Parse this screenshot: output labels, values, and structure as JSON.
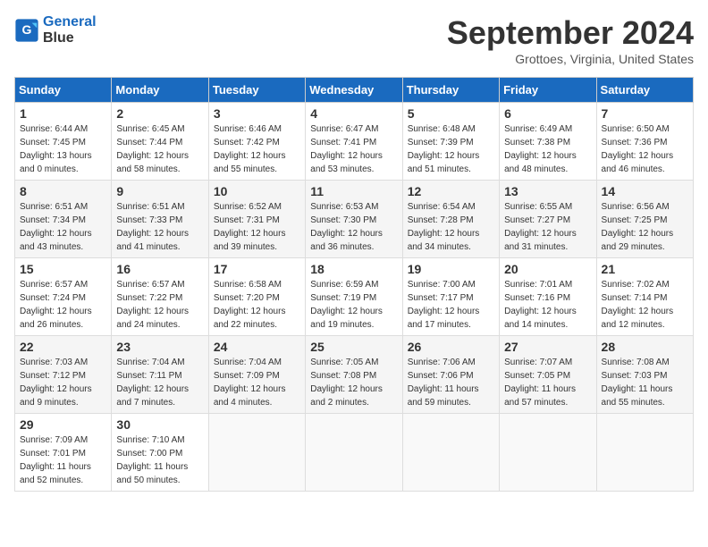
{
  "header": {
    "logo_line1": "General",
    "logo_line2": "Blue",
    "month_title": "September 2024",
    "location": "Grottoes, Virginia, United States"
  },
  "columns": [
    "Sunday",
    "Monday",
    "Tuesday",
    "Wednesday",
    "Thursday",
    "Friday",
    "Saturday"
  ],
  "weeks": [
    [
      {
        "day": "1",
        "info": "Sunrise: 6:44 AM\nSunset: 7:45 PM\nDaylight: 13 hours\nand 0 minutes."
      },
      {
        "day": "2",
        "info": "Sunrise: 6:45 AM\nSunset: 7:44 PM\nDaylight: 12 hours\nand 58 minutes."
      },
      {
        "day": "3",
        "info": "Sunrise: 6:46 AM\nSunset: 7:42 PM\nDaylight: 12 hours\nand 55 minutes."
      },
      {
        "day": "4",
        "info": "Sunrise: 6:47 AM\nSunset: 7:41 PM\nDaylight: 12 hours\nand 53 minutes."
      },
      {
        "day": "5",
        "info": "Sunrise: 6:48 AM\nSunset: 7:39 PM\nDaylight: 12 hours\nand 51 minutes."
      },
      {
        "day": "6",
        "info": "Sunrise: 6:49 AM\nSunset: 7:38 PM\nDaylight: 12 hours\nand 48 minutes."
      },
      {
        "day": "7",
        "info": "Sunrise: 6:50 AM\nSunset: 7:36 PM\nDaylight: 12 hours\nand 46 minutes."
      }
    ],
    [
      {
        "day": "8",
        "info": "Sunrise: 6:51 AM\nSunset: 7:34 PM\nDaylight: 12 hours\nand 43 minutes."
      },
      {
        "day": "9",
        "info": "Sunrise: 6:51 AM\nSunset: 7:33 PM\nDaylight: 12 hours\nand 41 minutes."
      },
      {
        "day": "10",
        "info": "Sunrise: 6:52 AM\nSunset: 7:31 PM\nDaylight: 12 hours\nand 39 minutes."
      },
      {
        "day": "11",
        "info": "Sunrise: 6:53 AM\nSunset: 7:30 PM\nDaylight: 12 hours\nand 36 minutes."
      },
      {
        "day": "12",
        "info": "Sunrise: 6:54 AM\nSunset: 7:28 PM\nDaylight: 12 hours\nand 34 minutes."
      },
      {
        "day": "13",
        "info": "Sunrise: 6:55 AM\nSunset: 7:27 PM\nDaylight: 12 hours\nand 31 minutes."
      },
      {
        "day": "14",
        "info": "Sunrise: 6:56 AM\nSunset: 7:25 PM\nDaylight: 12 hours\nand 29 minutes."
      }
    ],
    [
      {
        "day": "15",
        "info": "Sunrise: 6:57 AM\nSunset: 7:24 PM\nDaylight: 12 hours\nand 26 minutes."
      },
      {
        "day": "16",
        "info": "Sunrise: 6:57 AM\nSunset: 7:22 PM\nDaylight: 12 hours\nand 24 minutes."
      },
      {
        "day": "17",
        "info": "Sunrise: 6:58 AM\nSunset: 7:20 PM\nDaylight: 12 hours\nand 22 minutes."
      },
      {
        "day": "18",
        "info": "Sunrise: 6:59 AM\nSunset: 7:19 PM\nDaylight: 12 hours\nand 19 minutes."
      },
      {
        "day": "19",
        "info": "Sunrise: 7:00 AM\nSunset: 7:17 PM\nDaylight: 12 hours\nand 17 minutes."
      },
      {
        "day": "20",
        "info": "Sunrise: 7:01 AM\nSunset: 7:16 PM\nDaylight: 12 hours\nand 14 minutes."
      },
      {
        "day": "21",
        "info": "Sunrise: 7:02 AM\nSunset: 7:14 PM\nDaylight: 12 hours\nand 12 minutes."
      }
    ],
    [
      {
        "day": "22",
        "info": "Sunrise: 7:03 AM\nSunset: 7:12 PM\nDaylight: 12 hours\nand 9 minutes."
      },
      {
        "day": "23",
        "info": "Sunrise: 7:04 AM\nSunset: 7:11 PM\nDaylight: 12 hours\nand 7 minutes."
      },
      {
        "day": "24",
        "info": "Sunrise: 7:04 AM\nSunset: 7:09 PM\nDaylight: 12 hours\nand 4 minutes."
      },
      {
        "day": "25",
        "info": "Sunrise: 7:05 AM\nSunset: 7:08 PM\nDaylight: 12 hours\nand 2 minutes."
      },
      {
        "day": "26",
        "info": "Sunrise: 7:06 AM\nSunset: 7:06 PM\nDaylight: 11 hours\nand 59 minutes."
      },
      {
        "day": "27",
        "info": "Sunrise: 7:07 AM\nSunset: 7:05 PM\nDaylight: 11 hours\nand 57 minutes."
      },
      {
        "day": "28",
        "info": "Sunrise: 7:08 AM\nSunset: 7:03 PM\nDaylight: 11 hours\nand 55 minutes."
      }
    ],
    [
      {
        "day": "29",
        "info": "Sunrise: 7:09 AM\nSunset: 7:01 PM\nDaylight: 11 hours\nand 52 minutes."
      },
      {
        "day": "30",
        "info": "Sunrise: 7:10 AM\nSunset: 7:00 PM\nDaylight: 11 hours\nand 50 minutes."
      },
      {
        "day": "",
        "info": ""
      },
      {
        "day": "",
        "info": ""
      },
      {
        "day": "",
        "info": ""
      },
      {
        "day": "",
        "info": ""
      },
      {
        "day": "",
        "info": ""
      }
    ]
  ]
}
